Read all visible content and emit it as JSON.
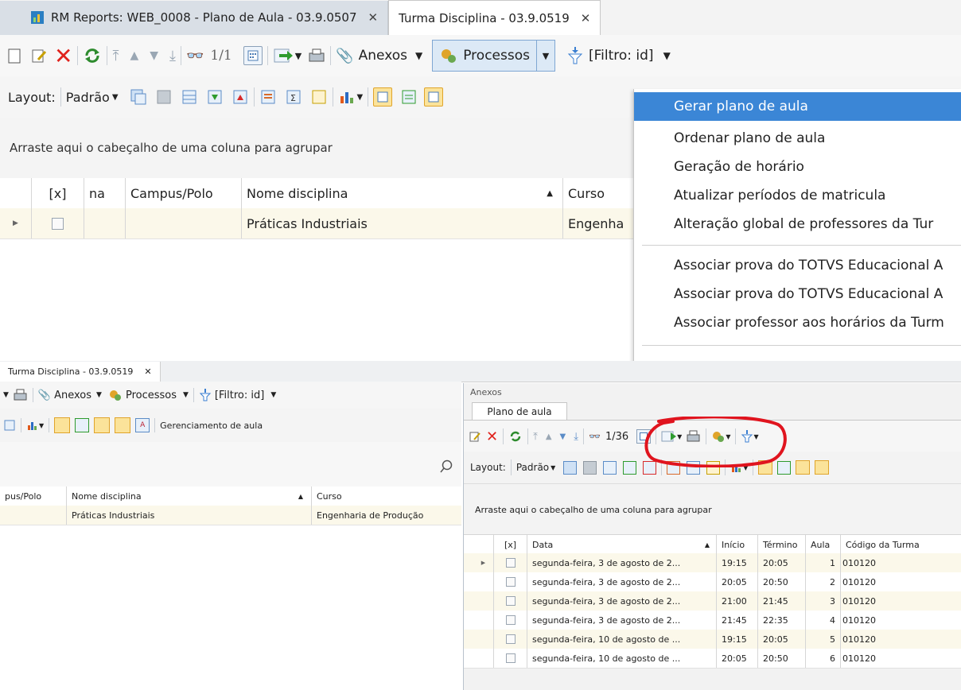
{
  "top": {
    "tabs": [
      {
        "label": "RM Reports: WEB_0008 - Plano de Aula - 03.9.0507"
      },
      {
        "label": "Turma Disciplina - 03.9.0519"
      }
    ],
    "toolbar": {
      "record_counter": "1/1",
      "anexos_label": "Anexos",
      "processos_label": "Processos",
      "filtro_label": "[Filtro: id]"
    },
    "layout_bar": {
      "layout_label": "Layout:",
      "padrao_label": "Padrão"
    },
    "group_hint": "Arraste aqui o cabeçalho de uma coluna para agrupar",
    "grid": {
      "columns": [
        "[x]",
        "na",
        "Campus/Polo",
        "Nome disciplina",
        "Curso"
      ],
      "row": {
        "campus": "",
        "disciplina": "Práticas Industriais",
        "curso": "Engenha"
      }
    }
  },
  "menu": {
    "items": [
      "Gerar plano de aula",
      "Ordenar plano de aula",
      "Geração de horário",
      "Atualizar períodos de matricula",
      "Alteração global de professores da Tur",
      "Associar prova do TOTVS Educacional A",
      "Associar prova do TOTVS Educacional A",
      "Associar professor aos horários da Turm"
    ],
    "highlighted_index": 0
  },
  "bottom": {
    "tab_label": "Turma Disciplina - 03.9.0519",
    "toolbar": {
      "anexos_label": "Anexos",
      "processos_label": "Processos",
      "filtro_label": "[Filtro: id]",
      "gerenciamento_label": "Gerenciamento de aula"
    },
    "grid": {
      "columns": [
        "pus/Polo",
        "Nome disciplina",
        "Curso"
      ],
      "row": {
        "disciplina": "Práticas Industriais",
        "curso": "Engenharia de Produção"
      }
    }
  },
  "anexos": {
    "panel_title": "Anexos",
    "tab_label": "Plano de aula",
    "record_counter": "1/36",
    "layout_label": "Layout:",
    "padrao_label": "Padrão",
    "group_hint": "Arraste aqui o cabeçalho de uma coluna para agrupar",
    "columns": [
      "[x]",
      "Data",
      "Início",
      "Término",
      "Aula",
      "Código da Turma"
    ],
    "rows": [
      {
        "data": "segunda-feira, 3 de agosto de 2...",
        "inicio": "19:15",
        "termino": "20:05",
        "aula": "1",
        "codigo": "010120"
      },
      {
        "data": "segunda-feira, 3 de agosto de 2...",
        "inicio": "20:05",
        "termino": "20:50",
        "aula": "2",
        "codigo": "010120"
      },
      {
        "data": "segunda-feira, 3 de agosto de 2...",
        "inicio": "21:00",
        "termino": "21:45",
        "aula": "3",
        "codigo": "010120"
      },
      {
        "data": "segunda-feira, 3 de agosto de 2...",
        "inicio": "21:45",
        "termino": "22:35",
        "aula": "4",
        "codigo": "010120"
      },
      {
        "data": "segunda-feira, 10 de agosto de ...",
        "inicio": "19:15",
        "termino": "20:05",
        "aula": "5",
        "codigo": "010120"
      },
      {
        "data": "segunda-feira, 10 de agosto de ...",
        "inicio": "20:05",
        "termino": "20:50",
        "aula": "6",
        "codigo": "010120"
      }
    ]
  },
  "colors": {
    "accent": "#3b86d6",
    "highlight_row": "#fbf8ea",
    "annotation": "#e0141e"
  }
}
